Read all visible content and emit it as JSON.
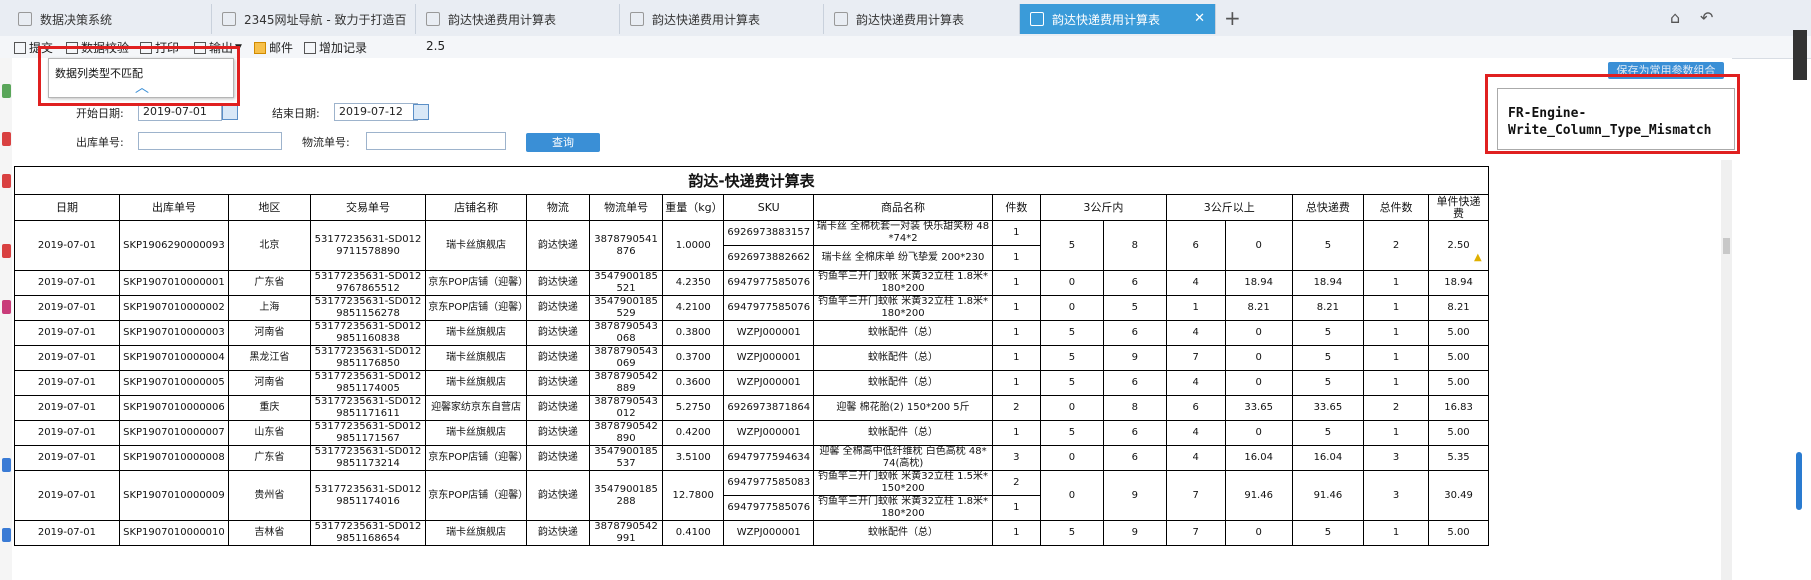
{
  "tabs": [
    {
      "label": "数据决策系统",
      "active": false
    },
    {
      "label": "2345网址导航 - 致力于打造百",
      "active": false
    },
    {
      "label": "韵达快递费用计算表",
      "active": false
    },
    {
      "label": "韵达快递费用计算表",
      "active": false
    },
    {
      "label": "韵达快递费用计算表",
      "active": false
    },
    {
      "label": "韵达快递费用计算表",
      "active": true
    }
  ],
  "toolbar": {
    "submit": "提交",
    "check": "数据校验",
    "print": "打印",
    "export": "输出",
    "mail": "邮件",
    "add_record": "增加记录",
    "version": "2.5"
  },
  "popup": {
    "message": "数据列类型不匹配"
  },
  "error_text": "FR-Engine-\nWrite_Column_Type_Mismatch",
  "save_button": "保存为常用参数组合",
  "params": {
    "start_label": "开始日期:",
    "start_value": "2019-07-01",
    "end_label": "结束日期:",
    "end_value": "2019-07-12",
    "out_no_label": "出库单号:",
    "logistics_no_label": "物流单号:",
    "query_button": "查询"
  },
  "report": {
    "title": "韵达-快递费计算表",
    "headers": [
      "日期",
      "出库单号",
      "地区",
      "交易单号",
      "店铺名称",
      "物流",
      "物流单号",
      "重量（kg）",
      "SKU",
      "商品名称",
      "件数",
      "3公斤内",
      "",
      "3公斤以上",
      "",
      "总快递费",
      "总件数",
      "单件快递费"
    ],
    "rows": [
      {
        "date": "2019-07-01",
        "out_no": "SKP1906290000093",
        "region": "北京",
        "trade_no": "53177235631-SD0129711578890",
        "shop": "瑞卡丝旗舰店",
        "logistics": "韵达快递",
        "tracking": "3878790541876",
        "weight": "1.0000",
        "items": [
          {
            "sku": "6926973883157",
            "name": "瑞卡丝 全棉枕套一对装 快乐甜笑粉 48*74*2",
            "qty": "1"
          },
          {
            "sku": "6926973882662",
            "name": "瑞卡丝 全棉床单 纷飞挚爱 200*230",
            "qty": "1"
          }
        ],
        "c1": "5",
        "c2": "8",
        "c3": "6",
        "c4": "0",
        "total": "5",
        "count": "2",
        "unit": "2.50"
      },
      {
        "date": "2019-07-01",
        "out_no": "SKP1907010000001",
        "region": "广东省",
        "trade_no": "53177235631-SD0129767865512",
        "shop": "京东POP店铺（迎馨）",
        "logistics": "韵达快递",
        "tracking": "3547900185521",
        "weight": "4.2350",
        "items": [
          {
            "sku": "6947977585076",
            "name": "钓鱼竿三开门蚊帐 米黄32立柱 1.8米*180*200",
            "qty": "1"
          }
        ],
        "c1": "0",
        "c2": "6",
        "c3": "4",
        "c4": "18.94",
        "total": "18.94",
        "count": "1",
        "unit": "18.94"
      },
      {
        "date": "2019-07-01",
        "out_no": "SKP1907010000002",
        "region": "上海",
        "trade_no": "53177235631-SD0129851156278",
        "shop": "京东POP店铺（迎馨）",
        "logistics": "韵达快递",
        "tracking": "3547900185529",
        "weight": "4.2100",
        "items": [
          {
            "sku": "6947977585076",
            "name": "钓鱼竿三开门蚊帐 米黄32立柱 1.8米*180*200",
            "qty": "1"
          }
        ],
        "c1": "0",
        "c2": "5",
        "c3": "1",
        "c4": "8.21",
        "total": "8.21",
        "count": "1",
        "unit": "8.21"
      },
      {
        "date": "2019-07-01",
        "out_no": "SKP1907010000003",
        "region": "河南省",
        "trade_no": "53177235631-SD0129851160838",
        "shop": "瑞卡丝旗舰店",
        "logistics": "韵达快递",
        "tracking": "3878790543068",
        "weight": "0.3800",
        "items": [
          {
            "sku": "WZPJ000001",
            "name": "蚊帐配件（总）",
            "qty": "1"
          }
        ],
        "c1": "5",
        "c2": "6",
        "c3": "4",
        "c4": "0",
        "total": "5",
        "count": "1",
        "unit": "5.00"
      },
      {
        "date": "2019-07-01",
        "out_no": "SKP1907010000004",
        "region": "黑龙江省",
        "trade_no": "53177235631-SD0129851176850",
        "shop": "瑞卡丝旗舰店",
        "logistics": "韵达快递",
        "tracking": "3878790543069",
        "weight": "0.3700",
        "items": [
          {
            "sku": "WZPJ000001",
            "name": "蚊帐配件（总）",
            "qty": "1"
          }
        ],
        "c1": "5",
        "c2": "9",
        "c3": "7",
        "c4": "0",
        "total": "5",
        "count": "1",
        "unit": "5.00"
      },
      {
        "date": "2019-07-01",
        "out_no": "SKP1907010000005",
        "region": "河南省",
        "trade_no": "53177235631-SD0129851174005",
        "shop": "瑞卡丝旗舰店",
        "logistics": "韵达快递",
        "tracking": "3878790542889",
        "weight": "0.3600",
        "items": [
          {
            "sku": "WZPJ000001",
            "name": "蚊帐配件（总）",
            "qty": "1"
          }
        ],
        "c1": "5",
        "c2": "6",
        "c3": "4",
        "c4": "0",
        "total": "5",
        "count": "1",
        "unit": "5.00"
      },
      {
        "date": "2019-07-01",
        "out_no": "SKP1907010000006",
        "region": "重庆",
        "trade_no": "53177235631-SD0129851171611",
        "shop": "迎馨家纺京东自营店",
        "logistics": "韵达快递",
        "tracking": "3878790543012",
        "weight": "5.2750",
        "items": [
          {
            "sku": "6926973871864",
            "name": "迎馨 棉花胎(2) 150*200 5斤",
            "qty": "2"
          }
        ],
        "c1": "0",
        "c2": "8",
        "c3": "6",
        "c4": "33.65",
        "total": "33.65",
        "count": "2",
        "unit": "16.83"
      },
      {
        "date": "2019-07-01",
        "out_no": "SKP1907010000007",
        "region": "山东省",
        "trade_no": "53177235631-SD0129851171567",
        "shop": "瑞卡丝旗舰店",
        "logistics": "韵达快递",
        "tracking": "3878790542890",
        "weight": "0.4200",
        "items": [
          {
            "sku": "WZPJ000001",
            "name": "蚊帐配件（总）",
            "qty": "1"
          }
        ],
        "c1": "5",
        "c2": "6",
        "c3": "4",
        "c4": "0",
        "total": "5",
        "count": "1",
        "unit": "5.00"
      },
      {
        "date": "2019-07-01",
        "out_no": "SKP1907010000008",
        "region": "广东省",
        "trade_no": "53177235631-SD0129851173214",
        "shop": "京东POP店铺（迎馨）",
        "logistics": "韵达快递",
        "tracking": "3547900185537",
        "weight": "3.5100",
        "items": [
          {
            "sku": "6947977594634",
            "name": "迎馨 全棉高中低纤维枕 白色高枕 48*74(高枕)",
            "qty": "3"
          }
        ],
        "c1": "0",
        "c2": "6",
        "c3": "4",
        "c4": "16.04",
        "total": "16.04",
        "count": "3",
        "unit": "5.35"
      },
      {
        "date": "2019-07-01",
        "out_no": "SKP1907010000009",
        "region": "贵州省",
        "trade_no": "53177235631-SD0129851174016",
        "shop": "京东POP店铺（迎馨）",
        "logistics": "韵达快递",
        "tracking": "3547900185288",
        "weight": "12.7800",
        "items": [
          {
            "sku": "6947977585083",
            "name": "钓鱼竿三开门蚊帐 米黄32立柱 1.5米*150*200",
            "qty": "2"
          },
          {
            "sku": "6947977585076",
            "name": "钓鱼竿三开门蚊帐 米黄32立柱 1.8米*180*200",
            "qty": "1"
          }
        ],
        "c1": "0",
        "c2": "9",
        "c3": "7",
        "c4": "91.46",
        "total": "91.46",
        "count": "3",
        "unit": "30.49"
      },
      {
        "date": "2019-07-01",
        "out_no": "SKP1907010000010",
        "region": "吉林省",
        "trade_no": "53177235631-SD0129851168654",
        "shop": "瑞卡丝旗舰店",
        "logistics": "韵达快递",
        "tracking": "3878790542991",
        "weight": "0.4100",
        "items": [
          {
            "sku": "WZPJ000001",
            "name": "蚊帐配件（总）",
            "qty": "1"
          }
        ],
        "c1": "5",
        "c2": "9",
        "c3": "7",
        "c4": "0",
        "total": "5",
        "count": "1",
        "unit": "5.00"
      }
    ]
  }
}
